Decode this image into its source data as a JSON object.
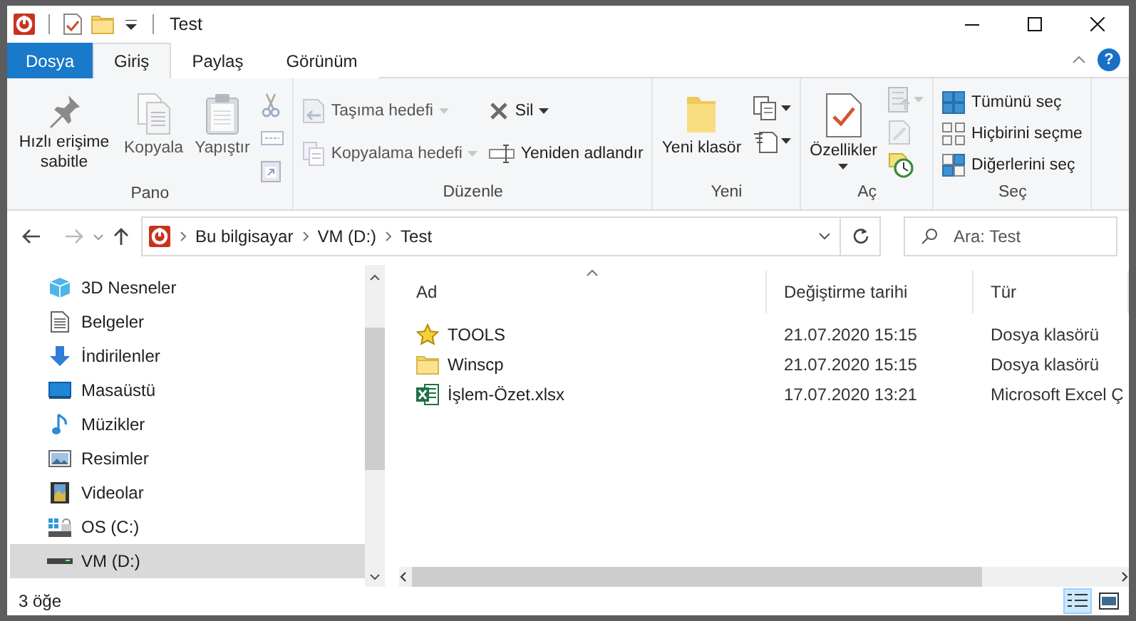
{
  "window": {
    "title": "Test"
  },
  "tabs": [
    {
      "label": "Dosya",
      "kind": "file",
      "selected": false
    },
    {
      "label": "Giriş",
      "kind": "tab",
      "selected": true
    },
    {
      "label": "Paylaş",
      "kind": "tab",
      "selected": false
    },
    {
      "label": "Görünüm",
      "kind": "tab",
      "selected": false
    }
  ],
  "help_button": {
    "label": "?"
  },
  "ribbon": {
    "groups": [
      {
        "title": "Pano",
        "columns": [
          [
            {
              "kind": "large",
              "label": "Hızlı erişime sabitle",
              "disabled": false
            }
          ],
          [
            {
              "kind": "large",
              "label": "Kopyala",
              "disabled": true
            }
          ],
          [
            {
              "kind": "large",
              "label": "Yapıştır",
              "disabled": true
            }
          ],
          [
            {
              "kind": "icon",
              "disabled": true
            },
            {
              "kind": "icon",
              "disabled": true
            },
            {
              "kind": "icon",
              "disabled": true
            }
          ]
        ]
      },
      {
        "title": "Düzenle",
        "columns": [
          [
            {
              "kind": "small",
              "label": "Taşıma hedefi",
              "dropdown": true,
              "disabled": true
            },
            {
              "kind": "small",
              "label": "Kopyalama hedefi",
              "dropdown": true,
              "disabled": true
            }
          ],
          [
            {
              "kind": "small",
              "label": "Sil",
              "dropdown": true,
              "disabled": false
            },
            {
              "kind": "small",
              "label": "Yeniden adlandır",
              "disabled": false
            }
          ]
        ]
      },
      {
        "title": "Yeni",
        "columns": [
          [
            {
              "kind": "large",
              "label": "Yeni klasör",
              "disabled": false
            }
          ],
          [
            {
              "kind": "icon",
              "dropdown": true,
              "disabled": false
            },
            {
              "kind": "icon",
              "dropdown": true,
              "disabled": false
            }
          ]
        ]
      },
      {
        "title": "Aç",
        "columns": [
          [
            {
              "kind": "large",
              "label": "Özellikler",
              "dropdown": true,
              "disabled": false
            }
          ],
          [
            {
              "kind": "icon",
              "dropdown": true,
              "disabled": true
            },
            {
              "kind": "icon",
              "disabled": true
            },
            {
              "kind": "icon",
              "disabled": false
            }
          ]
        ]
      },
      {
        "title": "Seç",
        "columns": [
          [
            {
              "kind": "small",
              "label": "Tümünü seç",
              "disabled": false
            },
            {
              "kind": "small",
              "label": "Hiçbirini seçme",
              "disabled": false
            },
            {
              "kind": "small",
              "label": "Diğerlerini seç",
              "disabled": false
            }
          ]
        ]
      }
    ]
  },
  "address": {
    "crumbs": [
      "Bu bilgisayar",
      "VM (D:)",
      "Test"
    ]
  },
  "search": {
    "placeholder": "Ara: Test"
  },
  "nav": {
    "items": [
      {
        "kind": "objects-3d",
        "label": "3D Nesneler",
        "selected": false
      },
      {
        "kind": "documents",
        "label": "Belgeler",
        "selected": false
      },
      {
        "kind": "downloads",
        "label": "İndirilenler",
        "selected": false
      },
      {
        "kind": "desktop",
        "label": "Masaüstü",
        "selected": false
      },
      {
        "kind": "music",
        "label": "Müzikler",
        "selected": false
      },
      {
        "kind": "pictures",
        "label": "Resimler",
        "selected": false
      },
      {
        "kind": "videos",
        "label": "Videolar",
        "selected": false
      },
      {
        "kind": "system-drive",
        "label": "OS (C:)",
        "selected": false
      },
      {
        "kind": "drive",
        "label": "VM (D:)",
        "selected": true
      }
    ]
  },
  "files": {
    "columns": [
      "Ad",
      "Değiştirme tarihi",
      "Tür"
    ],
    "rows": [
      {
        "kind": "starred-folder",
        "name": "TOOLS",
        "modified": "21.07.2020 15:15",
        "type": "Dosya klasörü"
      },
      {
        "kind": "folder",
        "name": "Winscp",
        "modified": "21.07.2020 15:15",
        "type": "Dosya klasörü"
      },
      {
        "kind": "excel",
        "name": "İşlem-Özet.xlsx",
        "modified": "17.07.2020 13:21",
        "type": "Microsoft Excel Ç"
      }
    ]
  },
  "status_bar": {
    "item_count": "3 öğe",
    "views": [
      {
        "kind": "details",
        "selected": true
      },
      {
        "kind": "tiles",
        "selected": false
      }
    ]
  }
}
